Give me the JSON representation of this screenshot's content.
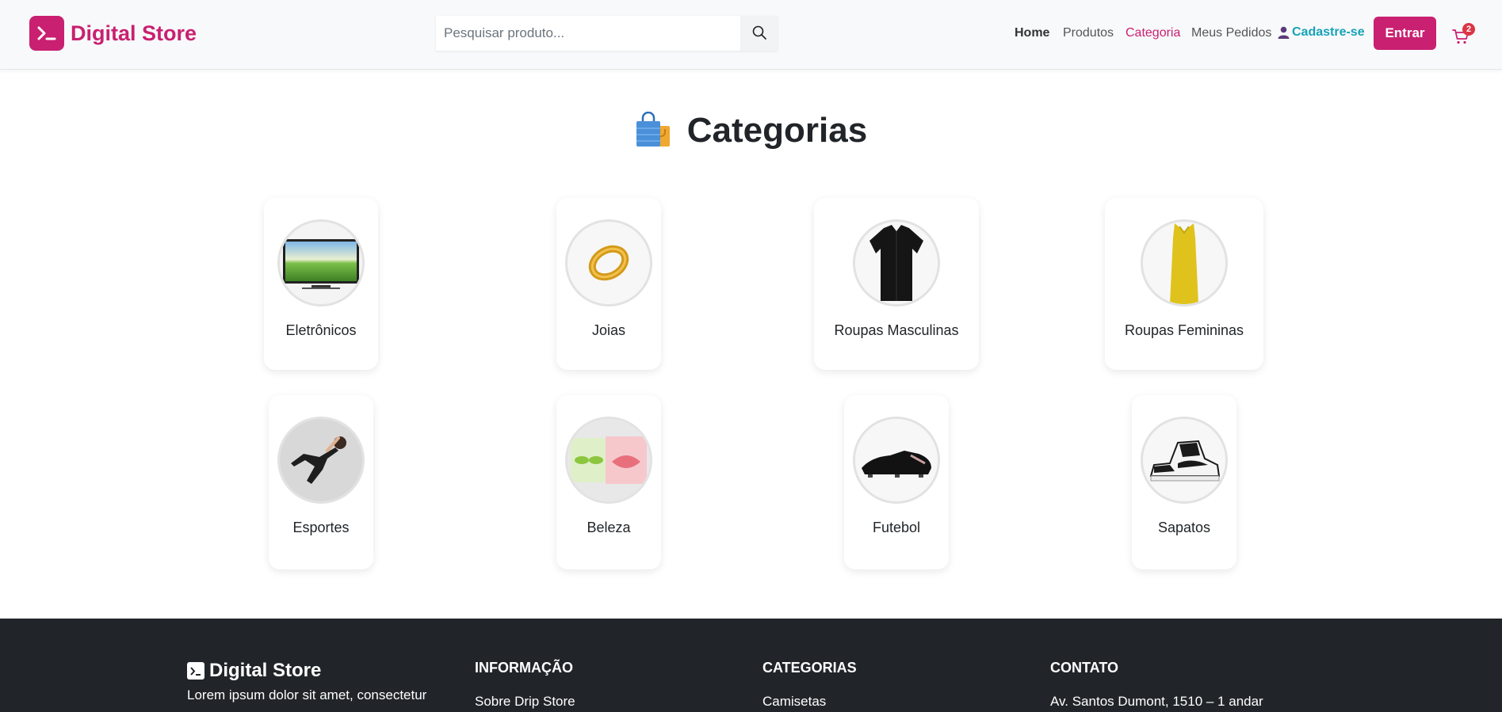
{
  "header": {
    "logo_text": "Digital Store",
    "search_placeholder": "Pesquisar produto...",
    "nav": {
      "home": "Home",
      "produtos": "Produtos",
      "categoria": "Categoria",
      "pedidos": "Meus Pedidos",
      "cadastro": "Cadastre-se"
    },
    "login_label": "Entrar",
    "cart_count": "2"
  },
  "main": {
    "title": "Categorias",
    "categories": [
      {
        "label": "Eletrônicos"
      },
      {
        "label": "Joias"
      },
      {
        "label": "Roupas Masculinas"
      },
      {
        "label": "Roupas Femininas"
      },
      {
        "label": "Esportes"
      },
      {
        "label": "Beleza"
      },
      {
        "label": "Futebol"
      },
      {
        "label": "Sapatos"
      }
    ]
  },
  "footer": {
    "brand": "Digital Store",
    "description": "Lorem ipsum dolor sit amet, consectetur",
    "info_heading": "INFORMAÇÃO",
    "info_item": "Sobre Drip Store",
    "cat_heading": "CATEGORIAS",
    "cat_item": "Camisetas",
    "contact_heading": "CONTATO",
    "contact_item": "Av. Santos Dumont, 1510 – 1 andar"
  },
  "colors": {
    "brand": "#c92071",
    "header_bg": "#f8f9fa",
    "link_cyan": "#17a2b8",
    "footer_bg": "#212529"
  },
  "icons": [
    "terminal-icon",
    "search-icon",
    "user-icon",
    "cart-icon",
    "shopping-bags-icon"
  ]
}
